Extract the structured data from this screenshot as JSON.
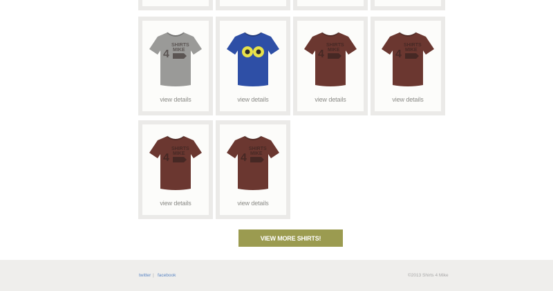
{
  "products": [
    {
      "details_label": "view details",
      "shirt": {
        "color": "#9a9a98",
        "graphic": "shirts-4-mike-logo"
      }
    },
    {
      "details_label": "view details",
      "shirt": {
        "color": "#2e4fa6",
        "graphic": "yellow-eyes"
      }
    },
    {
      "details_label": "view details",
      "shirt": {
        "color": "#6b3730",
        "graphic": "shirts-4-mike-logo"
      }
    },
    {
      "details_label": "view details",
      "shirt": {
        "color": "#6b3730",
        "graphic": "shirts-4-mike-logo"
      }
    },
    {
      "details_label": "view details",
      "shirt": {
        "color": "#6b3730",
        "graphic": "shirts-4-mike-logo"
      }
    },
    {
      "details_label": "view details",
      "shirt": {
        "color": "#6b3730",
        "graphic": "shirts-4-mike-logo"
      }
    }
  ],
  "view_more_label": "VIEW MORE SHIRTS!",
  "footer": {
    "twitter": "twitter",
    "separator": "|",
    "facebook": "facebook",
    "copyright": "©2013 Shirts 4 Mike"
  },
  "colors": {
    "accent": "#9b9b50",
    "link": "#5b86c4"
  }
}
